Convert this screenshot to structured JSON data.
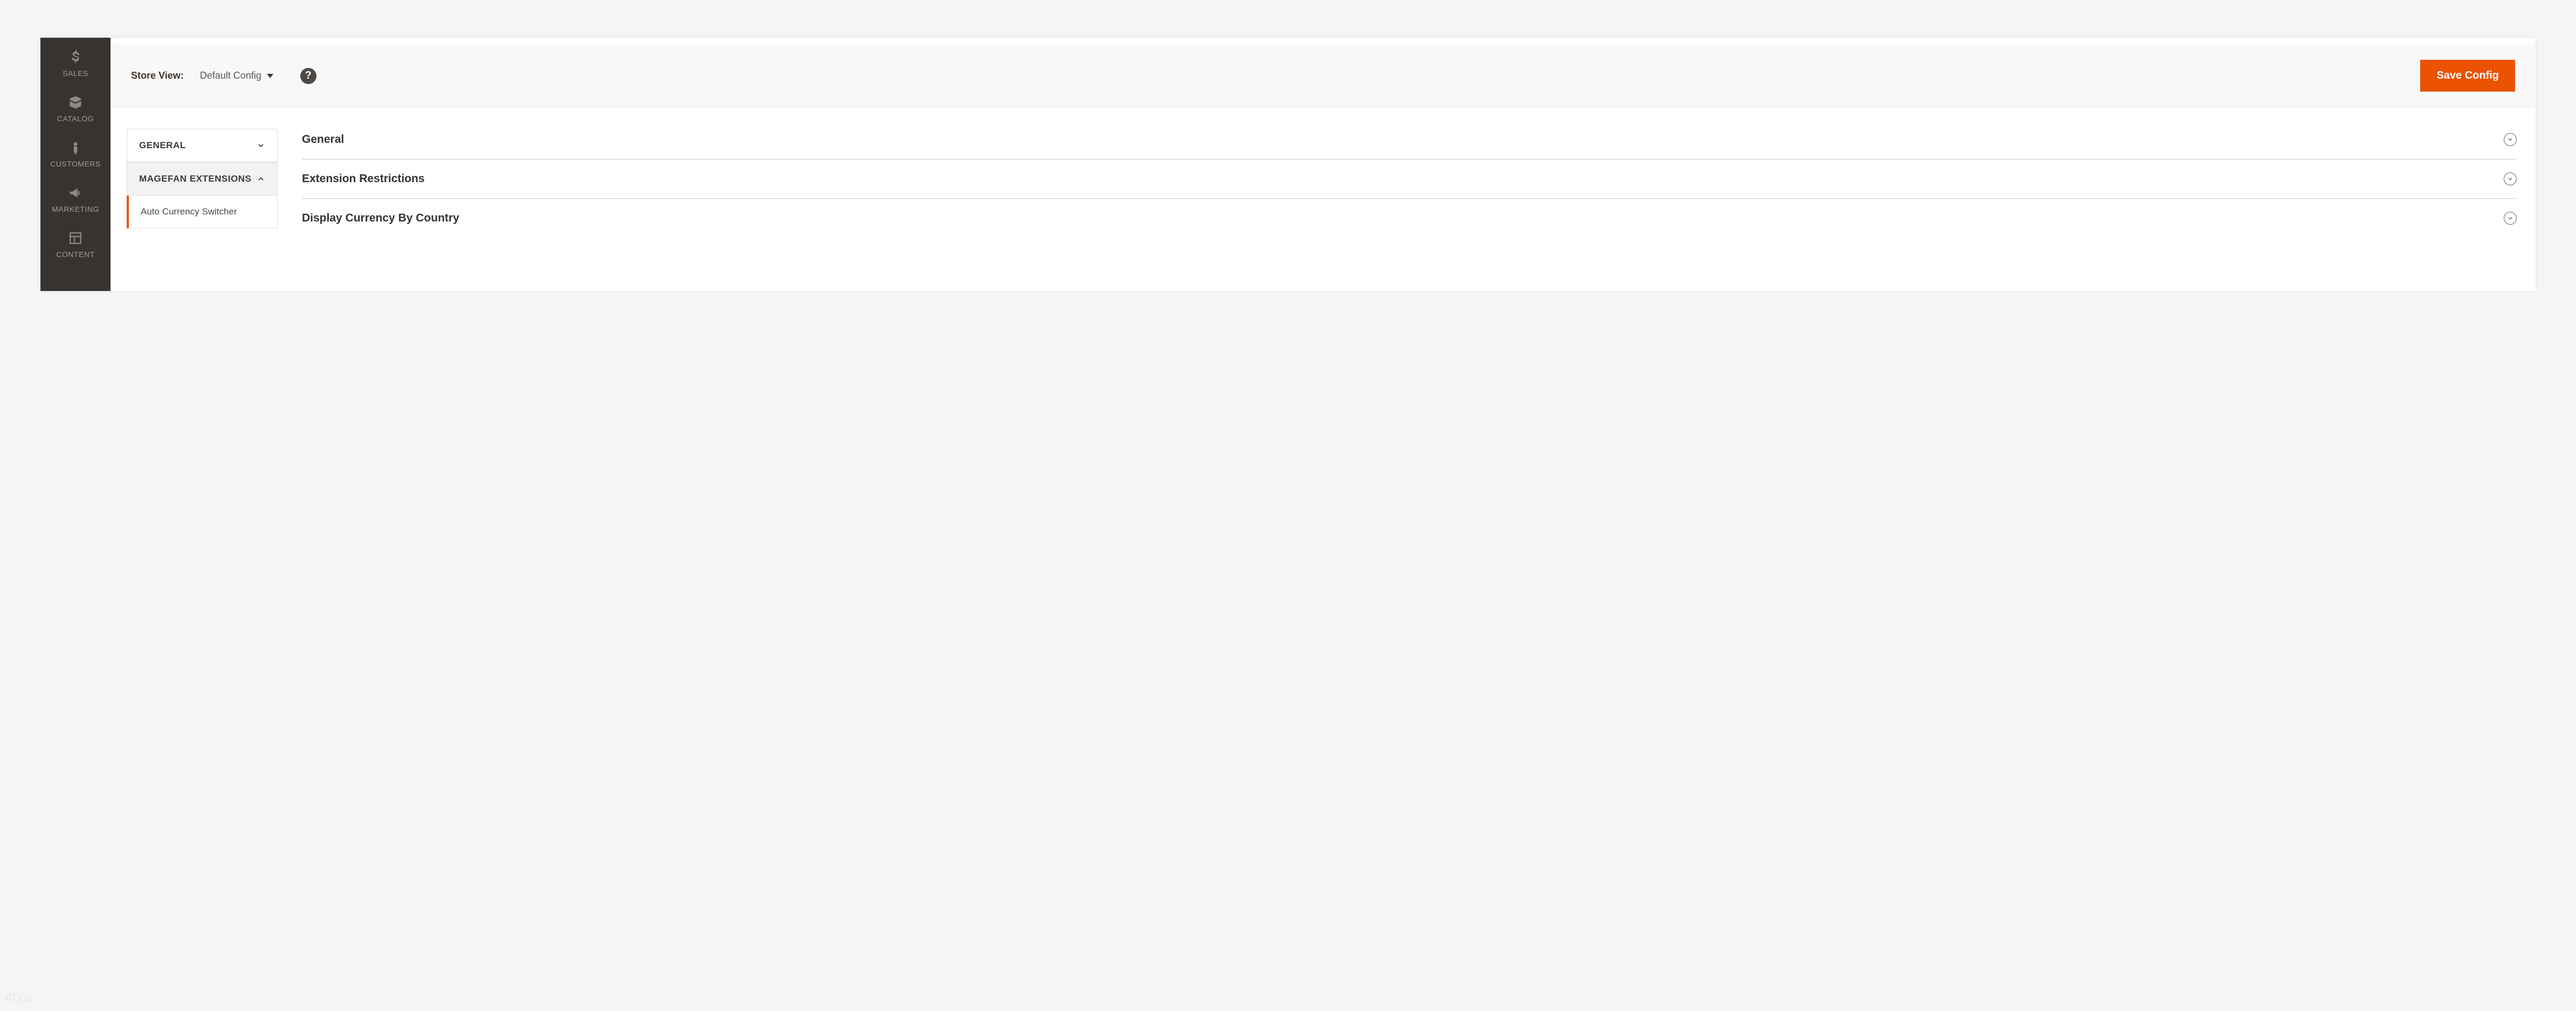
{
  "nav": {
    "items": [
      {
        "label": "SALES",
        "icon": "dollar-icon"
      },
      {
        "label": "CATALOG",
        "icon": "box-icon"
      },
      {
        "label": "CUSTOMERS",
        "icon": "person-icon"
      },
      {
        "label": "MARKETING",
        "icon": "megaphone-icon"
      },
      {
        "label": "CONTENT",
        "icon": "layout-icon"
      }
    ]
  },
  "topbar": {
    "store_view_label": "Store View:",
    "store_view_value": "Default Config",
    "help_glyph": "?",
    "save_label": "Save Config"
  },
  "config_sidebar": {
    "groups": [
      {
        "label": "GENERAL",
        "expanded": false
      },
      {
        "label": "MAGEFAN EXTENSIONS",
        "expanded": true
      }
    ],
    "active_item": "Auto Currency Switcher"
  },
  "sections": [
    {
      "title": "General"
    },
    {
      "title": "Extension Restrictions"
    },
    {
      "title": "Display Currency By Country"
    }
  ],
  "watermark": "40px"
}
